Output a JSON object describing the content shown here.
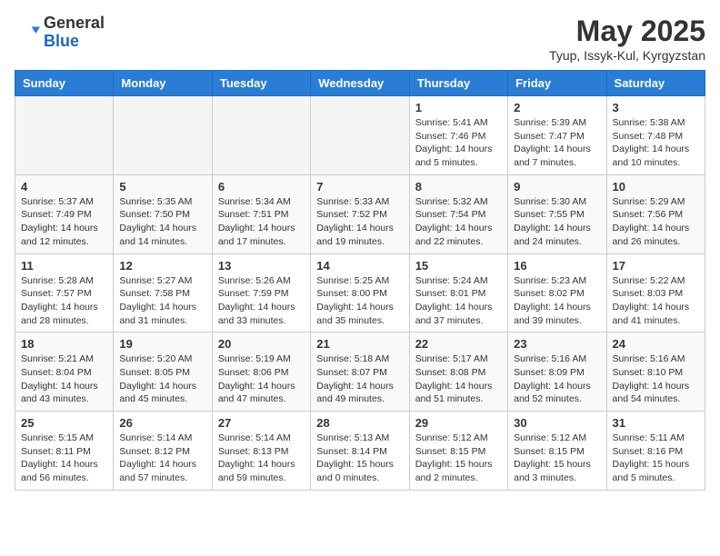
{
  "header": {
    "logo_general": "General",
    "logo_blue": "Blue",
    "month_title": "May 2025",
    "location": "Tyup, Issyk-Kul, Kyrgyzstan"
  },
  "weekdays": [
    "Sunday",
    "Monday",
    "Tuesday",
    "Wednesday",
    "Thursday",
    "Friday",
    "Saturday"
  ],
  "weeks": [
    [
      {
        "day": "",
        "info": ""
      },
      {
        "day": "",
        "info": ""
      },
      {
        "day": "",
        "info": ""
      },
      {
        "day": "",
        "info": ""
      },
      {
        "day": "1",
        "info": "Sunrise: 5:41 AM\nSunset: 7:46 PM\nDaylight: 14 hours\nand 5 minutes."
      },
      {
        "day": "2",
        "info": "Sunrise: 5:39 AM\nSunset: 7:47 PM\nDaylight: 14 hours\nand 7 minutes."
      },
      {
        "day": "3",
        "info": "Sunrise: 5:38 AM\nSunset: 7:48 PM\nDaylight: 14 hours\nand 10 minutes."
      }
    ],
    [
      {
        "day": "4",
        "info": "Sunrise: 5:37 AM\nSunset: 7:49 PM\nDaylight: 14 hours\nand 12 minutes."
      },
      {
        "day": "5",
        "info": "Sunrise: 5:35 AM\nSunset: 7:50 PM\nDaylight: 14 hours\nand 14 minutes."
      },
      {
        "day": "6",
        "info": "Sunrise: 5:34 AM\nSunset: 7:51 PM\nDaylight: 14 hours\nand 17 minutes."
      },
      {
        "day": "7",
        "info": "Sunrise: 5:33 AM\nSunset: 7:52 PM\nDaylight: 14 hours\nand 19 minutes."
      },
      {
        "day": "8",
        "info": "Sunrise: 5:32 AM\nSunset: 7:54 PM\nDaylight: 14 hours\nand 22 minutes."
      },
      {
        "day": "9",
        "info": "Sunrise: 5:30 AM\nSunset: 7:55 PM\nDaylight: 14 hours\nand 24 minutes."
      },
      {
        "day": "10",
        "info": "Sunrise: 5:29 AM\nSunset: 7:56 PM\nDaylight: 14 hours\nand 26 minutes."
      }
    ],
    [
      {
        "day": "11",
        "info": "Sunrise: 5:28 AM\nSunset: 7:57 PM\nDaylight: 14 hours\nand 28 minutes."
      },
      {
        "day": "12",
        "info": "Sunrise: 5:27 AM\nSunset: 7:58 PM\nDaylight: 14 hours\nand 31 minutes."
      },
      {
        "day": "13",
        "info": "Sunrise: 5:26 AM\nSunset: 7:59 PM\nDaylight: 14 hours\nand 33 minutes."
      },
      {
        "day": "14",
        "info": "Sunrise: 5:25 AM\nSunset: 8:00 PM\nDaylight: 14 hours\nand 35 minutes."
      },
      {
        "day": "15",
        "info": "Sunrise: 5:24 AM\nSunset: 8:01 PM\nDaylight: 14 hours\nand 37 minutes."
      },
      {
        "day": "16",
        "info": "Sunrise: 5:23 AM\nSunset: 8:02 PM\nDaylight: 14 hours\nand 39 minutes."
      },
      {
        "day": "17",
        "info": "Sunrise: 5:22 AM\nSunset: 8:03 PM\nDaylight: 14 hours\nand 41 minutes."
      }
    ],
    [
      {
        "day": "18",
        "info": "Sunrise: 5:21 AM\nSunset: 8:04 PM\nDaylight: 14 hours\nand 43 minutes."
      },
      {
        "day": "19",
        "info": "Sunrise: 5:20 AM\nSunset: 8:05 PM\nDaylight: 14 hours\nand 45 minutes."
      },
      {
        "day": "20",
        "info": "Sunrise: 5:19 AM\nSunset: 8:06 PM\nDaylight: 14 hours\nand 47 minutes."
      },
      {
        "day": "21",
        "info": "Sunrise: 5:18 AM\nSunset: 8:07 PM\nDaylight: 14 hours\nand 49 minutes."
      },
      {
        "day": "22",
        "info": "Sunrise: 5:17 AM\nSunset: 8:08 PM\nDaylight: 14 hours\nand 51 minutes."
      },
      {
        "day": "23",
        "info": "Sunrise: 5:16 AM\nSunset: 8:09 PM\nDaylight: 14 hours\nand 52 minutes."
      },
      {
        "day": "24",
        "info": "Sunrise: 5:16 AM\nSunset: 8:10 PM\nDaylight: 14 hours\nand 54 minutes."
      }
    ],
    [
      {
        "day": "25",
        "info": "Sunrise: 5:15 AM\nSunset: 8:11 PM\nDaylight: 14 hours\nand 56 minutes."
      },
      {
        "day": "26",
        "info": "Sunrise: 5:14 AM\nSunset: 8:12 PM\nDaylight: 14 hours\nand 57 minutes."
      },
      {
        "day": "27",
        "info": "Sunrise: 5:14 AM\nSunset: 8:13 PM\nDaylight: 14 hours\nand 59 minutes."
      },
      {
        "day": "28",
        "info": "Sunrise: 5:13 AM\nSunset: 8:14 PM\nDaylight: 15 hours\nand 0 minutes."
      },
      {
        "day": "29",
        "info": "Sunrise: 5:12 AM\nSunset: 8:15 PM\nDaylight: 15 hours\nand 2 minutes."
      },
      {
        "day": "30",
        "info": "Sunrise: 5:12 AM\nSunset: 8:15 PM\nDaylight: 15 hours\nand 3 minutes."
      },
      {
        "day": "31",
        "info": "Sunrise: 5:11 AM\nSunset: 8:16 PM\nDaylight: 15 hours\nand 5 minutes."
      }
    ]
  ]
}
